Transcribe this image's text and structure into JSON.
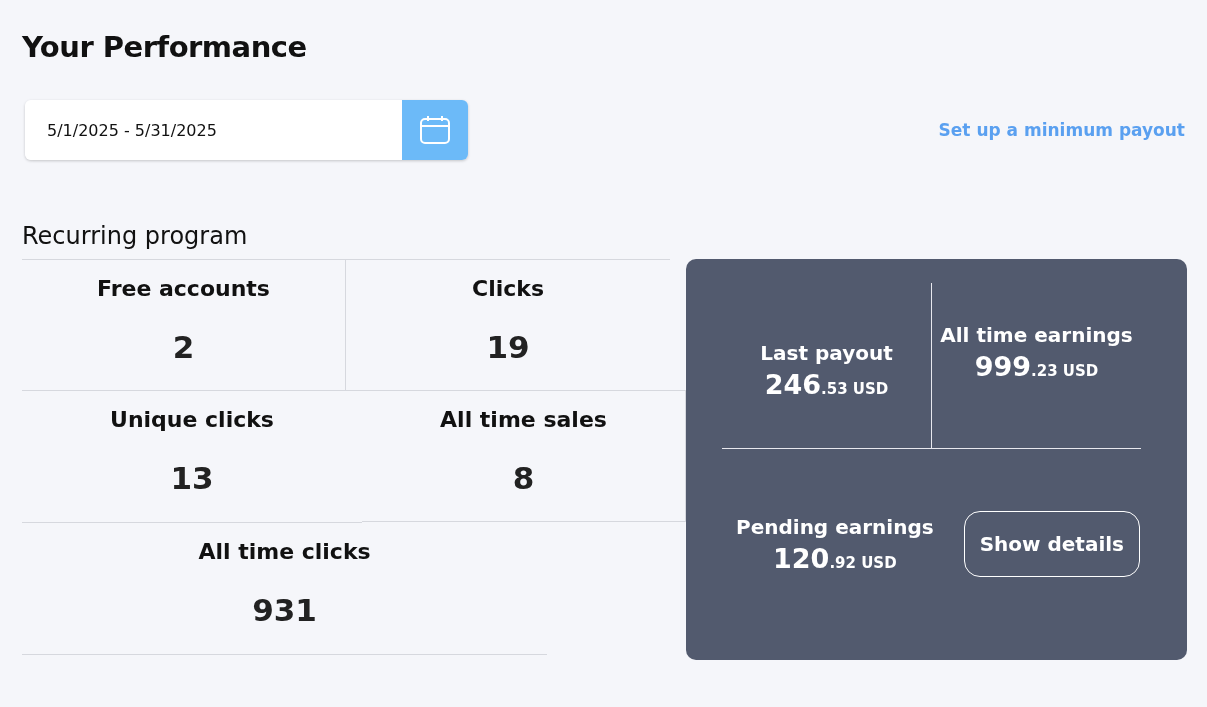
{
  "title": "Your Performance",
  "date_range": {
    "value": "5/1/2025 - 5/31/2025"
  },
  "payout_link": "Set up a minimum payout",
  "section_title": "Recurring program",
  "stats": [
    {
      "label": "Free accounts",
      "value": "2"
    },
    {
      "label": "Clicks",
      "value": "19"
    },
    {
      "label": "Unique clicks",
      "value": "13"
    },
    {
      "label": "All time sales",
      "value": "8"
    },
    {
      "label": "All time clicks",
      "value": "931"
    }
  ],
  "earnings": {
    "last_payout": {
      "label": "Last payout",
      "whole": "246",
      "cents": ".53",
      "currency": "USD"
    },
    "all_time": {
      "label": "All time earnings",
      "whole": "999",
      "cents": ".23",
      "currency": "USD"
    },
    "pending": {
      "label": "Pending earnings",
      "whole": "120",
      "cents": ".92",
      "currency": "USD"
    },
    "button": "Show details"
  }
}
